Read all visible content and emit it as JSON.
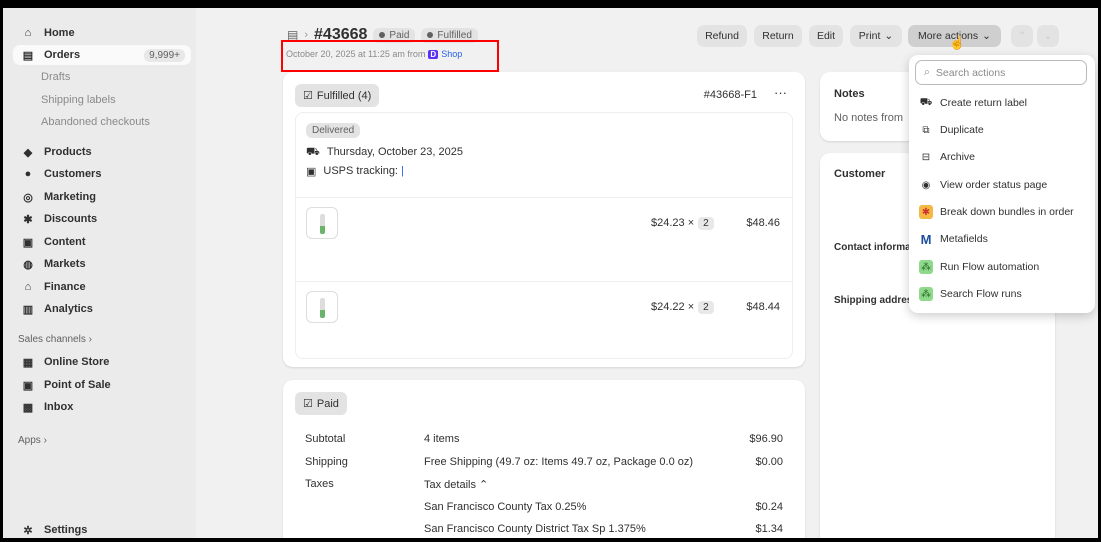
{
  "sidebar": {
    "items": [
      {
        "label": "Home"
      },
      {
        "label": "Orders",
        "count": "9,999+"
      },
      {
        "label": "Products"
      },
      {
        "label": "Customers"
      },
      {
        "label": "Marketing"
      },
      {
        "label": "Discounts"
      },
      {
        "label": "Content"
      },
      {
        "label": "Markets"
      },
      {
        "label": "Finance"
      },
      {
        "label": "Analytics"
      }
    ],
    "order_subs": [
      "Drafts",
      "Shipping labels",
      "Abandoned checkouts"
    ],
    "sales_channels_label": "Sales channels",
    "channels": [
      "Online Store",
      "Point of Sale",
      "Inbox"
    ],
    "apps_label": "Apps",
    "settings_label": "Settings"
  },
  "header": {
    "order_number": "#43668",
    "badges": [
      "Paid",
      "Fulfilled"
    ],
    "subtitle": "October 20, 2025 at 11:25 am from",
    "source": "Shop",
    "source_icon": "D",
    "buttons": {
      "refund": "Refund",
      "return": "Return",
      "edit": "Edit",
      "print": "Print",
      "more": "More actions"
    }
  },
  "fulfillment": {
    "label": "Fulfilled (4)",
    "id": "#43668-F1",
    "status": "Delivered",
    "date": "Thursday, October 23, 2025",
    "tracking_label": "USPS tracking:",
    "tracking_value": "|",
    "items": [
      {
        "price": "$24.23",
        "times": "×",
        "qty": "2",
        "total": "$48.46"
      },
      {
        "price": "$24.22",
        "times": "×",
        "qty": "2",
        "total": "$48.44"
      }
    ]
  },
  "payment": {
    "label": "Paid",
    "rows": [
      {
        "label": "Subtotal",
        "desc": "4 items",
        "amount": "$96.90"
      },
      {
        "label": "Shipping",
        "desc": "Free Shipping (49.7 oz: Items 49.7 oz, Package 0.0 oz)",
        "amount": "$0.00"
      },
      {
        "label": "Taxes",
        "desc": "Tax details",
        "amount": ""
      }
    ],
    "taxes": [
      {
        "desc": "San Francisco County Tax 0.25%",
        "amount": "$0.24"
      },
      {
        "desc": "San Francisco County District Tax Sp 1.375%",
        "amount": "$1.34"
      }
    ]
  },
  "notes": {
    "title": "Notes",
    "text": "No notes from"
  },
  "customer": {
    "title": "Customer",
    "contact": "Contact informa",
    "shipping": "Shipping addres"
  },
  "menu": {
    "search_placeholder": "Search actions",
    "items": [
      "Create return label",
      "Duplicate",
      "Archive",
      "View order status page",
      "Break down bundles in order",
      "Metafields",
      "Run Flow automation",
      "Search Flow runs"
    ]
  },
  "colors": {
    "highlight": "#ff0000",
    "link": "#2463eb"
  }
}
